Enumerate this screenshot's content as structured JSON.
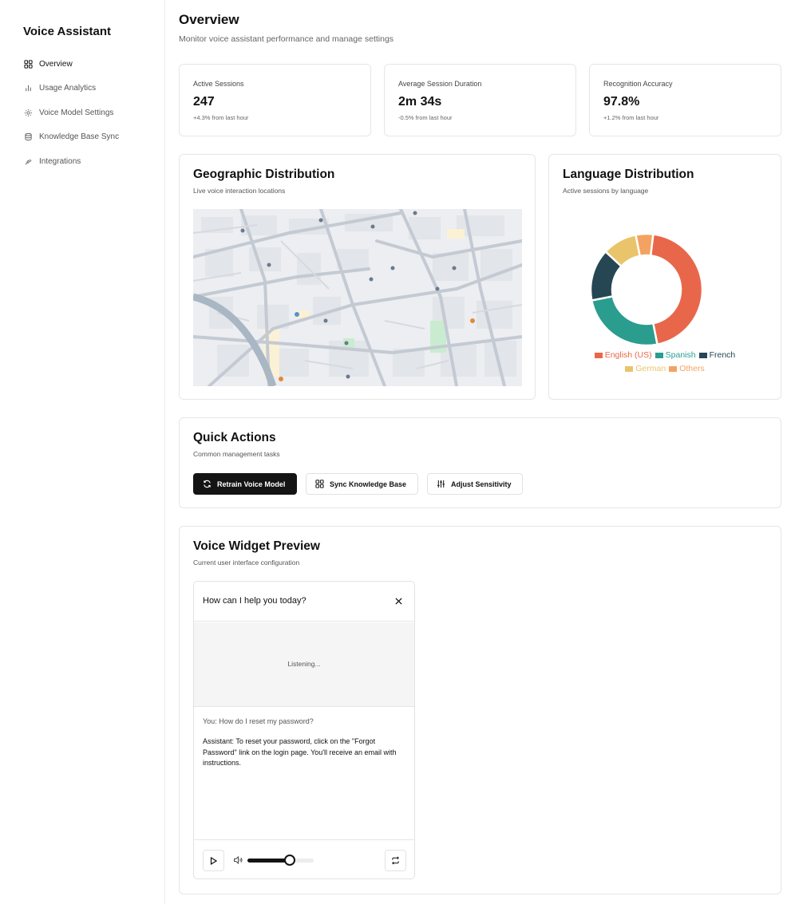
{
  "sidebar": {
    "brand": "Voice Assistant",
    "items": [
      {
        "label": "Overview",
        "icon": "grid-icon",
        "active": true
      },
      {
        "label": "Usage Analytics",
        "icon": "bar-chart-icon"
      },
      {
        "label": "Voice Model Settings",
        "icon": "gear-icon"
      },
      {
        "label": "Knowledge Base Sync",
        "icon": "database-icon"
      },
      {
        "label": "Integrations",
        "icon": "plug-icon"
      }
    ]
  },
  "header": {
    "title": "Overview",
    "subtitle": "Monitor voice assistant performance and manage settings"
  },
  "stats": [
    {
      "label": "Active Sessions",
      "value": "247",
      "change": "+4.3% from last hour"
    },
    {
      "label": "Average Session Duration",
      "value": "2m 34s",
      "change": "-0.5% from last hour"
    },
    {
      "label": "Recognition Accuracy",
      "value": "97.8%",
      "change": "+1.2% from last hour"
    }
  ],
  "geo": {
    "title": "Geographic Distribution",
    "subtitle": "Live voice interaction locations"
  },
  "language": {
    "title": "Language Distribution",
    "subtitle": "Active sessions by language"
  },
  "chart_data": {
    "type": "pie",
    "donut": true,
    "categories": [
      "English (US)",
      "Spanish",
      "French",
      "German",
      "Others"
    ],
    "values": [
      45,
      25,
      15,
      10,
      5
    ],
    "colors": [
      "#e8674a",
      "#2a9d8f",
      "#264653",
      "#e9c46a",
      "#f4a261"
    ],
    "legend": "bottom"
  },
  "quick_actions": {
    "title": "Quick Actions",
    "subtitle": "Common management tasks",
    "buttons": [
      {
        "label": "Retrain Voice Model",
        "icon": "refresh-icon"
      },
      {
        "label": "Sync Knowledge Base",
        "icon": "grid-icon"
      },
      {
        "label": "Adjust Sensitivity",
        "icon": "sliders-icon"
      }
    ]
  },
  "widget_preview": {
    "title": "Voice Widget Preview",
    "subtitle": "Current user interface configuration",
    "prompt": "How can I help you today?",
    "status": "Listening...",
    "user_message": "You: How do I reset my password?",
    "assistant_message": "Assistant: To reset your password, click on the \"Forgot Password\" link on the login page. You'll receive an email with instructions.",
    "volume": 0.64
  }
}
